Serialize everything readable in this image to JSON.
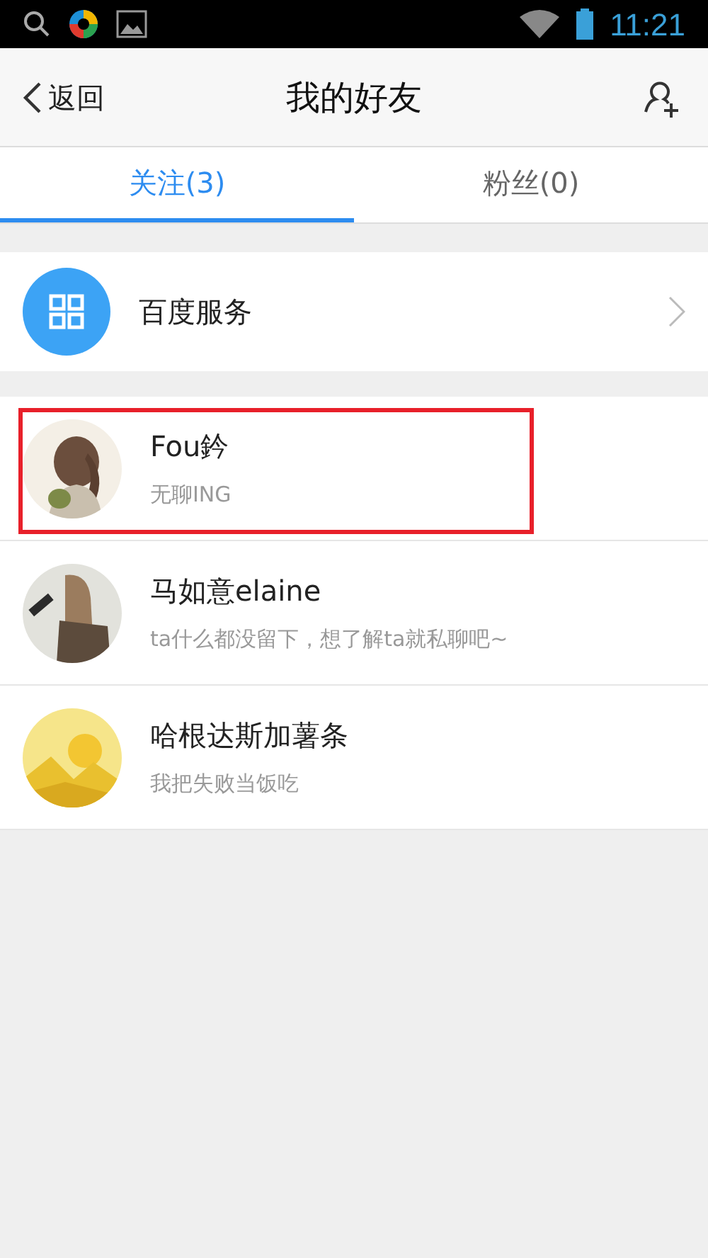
{
  "status_bar": {
    "time": "11:21"
  },
  "header": {
    "back": "返回",
    "title": "我的好友"
  },
  "tabs": [
    {
      "label": "关注(3)",
      "selected": true
    },
    {
      "label": "粉丝(0)",
      "selected": false
    }
  ],
  "service": {
    "label": "百度服务"
  },
  "friends": [
    {
      "name": "Fou鈐",
      "bio": "无聊ING",
      "highlighted": true
    },
    {
      "name": "马如意elaine",
      "bio": "ta什么都没留下，想了解ta就私聊吧~",
      "highlighted": false
    },
    {
      "name": "哈根达斯加薯条",
      "bio": "我把失败当饭吃",
      "highlighted": false
    }
  ]
}
